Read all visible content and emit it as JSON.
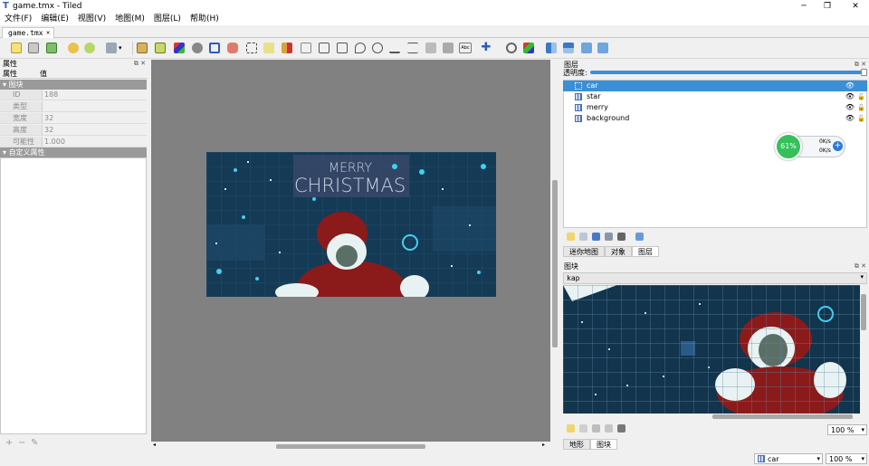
{
  "window": {
    "title": "game.tmx - Tiled",
    "app_icon": "tiled-logo-icon",
    "min_glyph": "─",
    "max_glyph": "❐",
    "close_glyph": "✕"
  },
  "menu": [
    "文件(F)",
    "编辑(E)",
    "视图(V)",
    "地图(M)",
    "图层(L)",
    "帮助(H)"
  ],
  "tab": {
    "label": "game.tmx",
    "close": "✕"
  },
  "properties": {
    "title": "属性",
    "col_name": "属性",
    "col_value": "值",
    "group_tile": "图块",
    "rows": [
      {
        "name": "ID",
        "value": "188"
      },
      {
        "name": "类型",
        "value": ""
      },
      {
        "name": "宽度",
        "value": "32"
      },
      {
        "name": "高度",
        "value": "32"
      },
      {
        "name": "可能性",
        "value": "1.000"
      }
    ],
    "group_custom": "自定义属性",
    "add": "+",
    "remove": "−",
    "edit": "✎"
  },
  "map": {
    "banner_line1": "MERRY",
    "banner_line2": "CHRISTMAS"
  },
  "layers": {
    "title": "图层",
    "opacity_label": "透明度:",
    "items": [
      {
        "name": "car",
        "selected": true
      },
      {
        "name": "star",
        "selected": false
      },
      {
        "name": "merry",
        "selected": false
      },
      {
        "name": "background",
        "selected": false
      }
    ],
    "tabs": [
      "迷你地图",
      "对象",
      "图层"
    ],
    "active_tab": "图层"
  },
  "net_widget": {
    "percent": "61%",
    "up": "0K/s",
    "down": "0K/s",
    "plus": "+"
  },
  "tilesets": {
    "title": "图块",
    "tab_name": "kap",
    "zoom": "100 %",
    "bottom_tabs": [
      "地形",
      "图块"
    ],
    "active_bottom_tab": "图块"
  },
  "status": {
    "layer": "car",
    "zoom": "100 %"
  },
  "colors": {
    "selection": "#3a8fd6",
    "canvas_bg": "#818181",
    "map_bg": "#143a55",
    "star": "#42d0f0"
  }
}
